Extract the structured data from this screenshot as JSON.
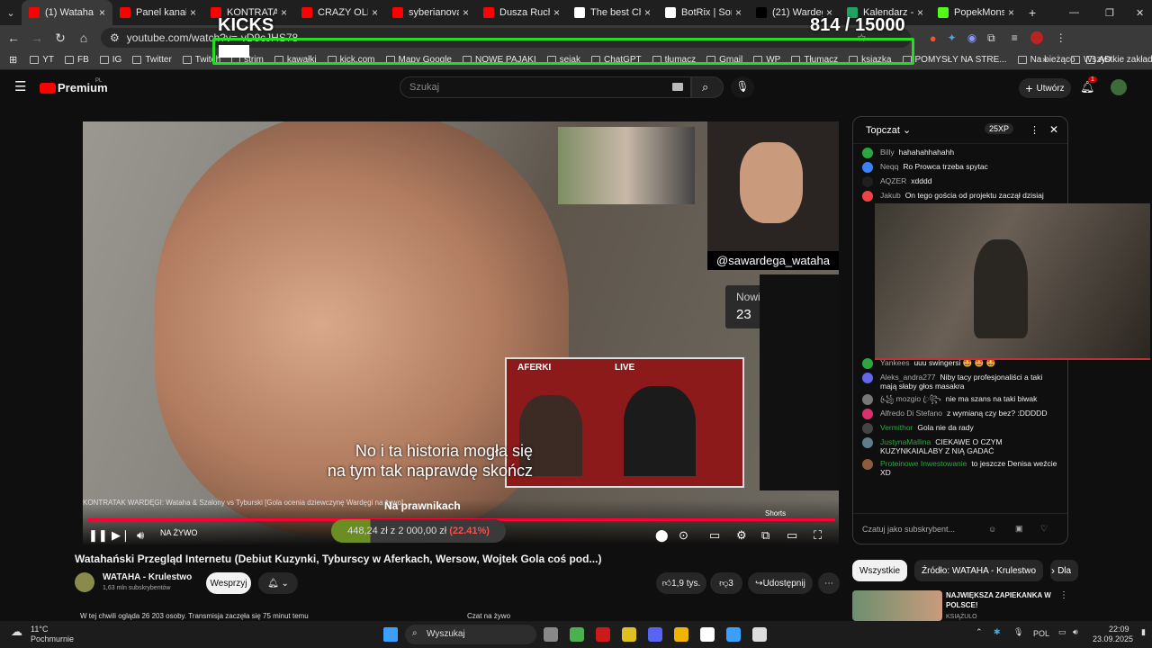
{
  "tabs": [
    {
      "title": "(1) Wataha",
      "active": true,
      "close": "×"
    },
    {
      "title": "Panel kanału -",
      "close": "×"
    },
    {
      "title": "KONTRATAK W",
      "close": "×"
    },
    {
      "title": "CRAZY OLIWK",
      "close": "×"
    },
    {
      "title": "syberianova -",
      "close": "×"
    },
    {
      "title": "Dusza Ruchac",
      "close": "×"
    },
    {
      "title": "The best Chatb",
      "close": "×"
    },
    {
      "title": "BotRix | Sortec",
      "close": "×"
    },
    {
      "title": "(21) Wardega",
      "close": "×"
    },
    {
      "title": "Kalendarz - Ar",
      "close": "×"
    },
    {
      "title": "PopekMonster",
      "close": "×"
    }
  ],
  "address": {
    "url": "youtube.com/watch?v=-vD9cJHS78"
  },
  "bookmarks": [
    "YT",
    "FB",
    "IG",
    "Twitter",
    "Twitch",
    "strim",
    "kawałki",
    "kick.com",
    "Mapy Google",
    "NOWE PAJAKI",
    "sejak",
    "ChatGPT",
    "tłumacz",
    "Gmail",
    "WP",
    "Tłumacz",
    "ksiazka",
    "POMYSŁY NA STRE...",
    "Na bieżąco",
    "AD"
  ],
  "bookmarks_right": "Wszystkie zakładki",
  "overlay": {
    "kicks": "KICKS",
    "goal": "814  / 15000"
  },
  "youtube": {
    "brand": "Premium",
    "brand_sup": "PL",
    "search_placeholder": "Szukaj",
    "create": "Utwórz",
    "notif_count": "1"
  },
  "player": {
    "subtitle_line1": "No i ta historia mogła się",
    "subtitle_line2": "na tym tak naprawdę skończ",
    "cam_label": "@sawardega_wataha",
    "supporters_label": "Nowi wspierający",
    "supporters_count": "23",
    "inset_caption": "KONTRATAK WARDĘGI: Wataha & Szalony vs Tyburski [Gola ocenia dziewczynę Wardęgi na żywo]",
    "banner": "Na prawnikach",
    "donation_text": "448,24 zł  z  2 000,00 zł",
    "donation_pct": "(22.41%)",
    "donation_fraction": 0.2241,
    "live": "NA ŻYWO",
    "aferki": "AFERKI",
    "aferki_live": "LIVE",
    "shorts": "Shorts"
  },
  "video": {
    "title": "Watahański Przegląd Internetu (Debiut Kuzynki, Tyburscy w Aferkach, Wersow, Wojtek Gola coś pod...)",
    "channel": "WATAHA - Krulestwo",
    "subs": "1,63 mln subskrybentów",
    "support": "Wesprzyj",
    "likes": "1,9 tys.",
    "dislikes": "3",
    "share": "Udostępnij"
  },
  "chat": {
    "mode": "Topczat",
    "xp": "25XP",
    "messages": [
      {
        "user": "Billy",
        "text": "hahahahhahahh",
        "color": "#2ba640"
      },
      {
        "user": "Neqq",
        "text": "Ro Prowca trzeba spytac",
        "color": "#3b82f6"
      },
      {
        "user": "AQZER",
        "text": "xdddd",
        "color": "#1f1f1f"
      },
      {
        "user": "Jakub",
        "text": "On tego gościa od projektu zaczął dzisiaj",
        "color": "#ef4444"
      },
      {
        "user": "Yankees",
        "text": "uuu swingersi 🤩 🤩 🤩",
        "color": "#2ba640"
      },
      {
        "user": "Aleks_andra277",
        "text": "Niby tacy profesjonaliści a taki mają słaby głos masakra",
        "color": "#6366f1"
      },
      {
        "user": "꧁ꦿ mozgio ꦿ꧂",
        "text": "nie ma szans na taki biwak",
        "color": "#777"
      },
      {
        "user": "Alfredo Di Stefano",
        "text": "z wymianą czy bez? :DDDDD",
        "color": "#d9316e"
      },
      {
        "user": "Vermithor",
        "text": "Gola nie da rady",
        "color": "#444",
        "green": true
      },
      {
        "user": "JustynaMallina",
        "text": "CIEKAWE O CZYM KUZYNKAIALABY Z NIĄ GADAĆ",
        "color": "#607d8b",
        "green": true
      },
      {
        "user": "Proteinowe Inwestowanie",
        "text": "to jeszcze Denisa weźcie XD",
        "color": "#8d5b3d",
        "green": true
      }
    ],
    "input_placeholder": "Czatuj jako subskrybent..."
  },
  "recs": {
    "chips": [
      "Wszystkie",
      "Źródło: WATAHA - Krulestwo",
      "Dla"
    ],
    "item_title": "NAJWIĘKSZA ZAPIEKANKA W POLSCE!",
    "item_channel": "KSIĄŻULO"
  },
  "below": {
    "viewers": "W tej chwili ogląda 26 203 osoby. Transmisja zaczęła się 75 minut temu",
    "live_chat": "Czat na żywo"
  },
  "taskbar": {
    "temp": "11°C",
    "weather": "Pochmurnie",
    "search": "Wyszukaj",
    "lang": "POL",
    "time": "22:09",
    "date": "23.09.2025"
  }
}
